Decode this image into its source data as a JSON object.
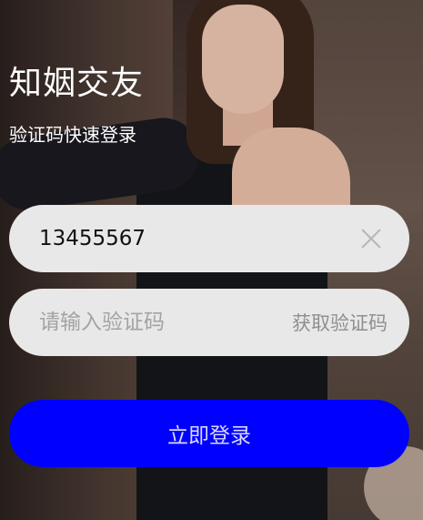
{
  "app": {
    "title": "知姻交友",
    "subtitle": "验证码快速登录"
  },
  "form": {
    "phone": {
      "value": "13455567",
      "clear_icon": "close-icon"
    },
    "code": {
      "value": "",
      "placeholder": "请输入验证码",
      "get_code_label": "获取验证码"
    },
    "submit_label": "立即登录"
  },
  "colors": {
    "primary_button": "#0000ff",
    "field_background": "#e8e8e8",
    "placeholder_text": "#a3a3a3"
  }
}
